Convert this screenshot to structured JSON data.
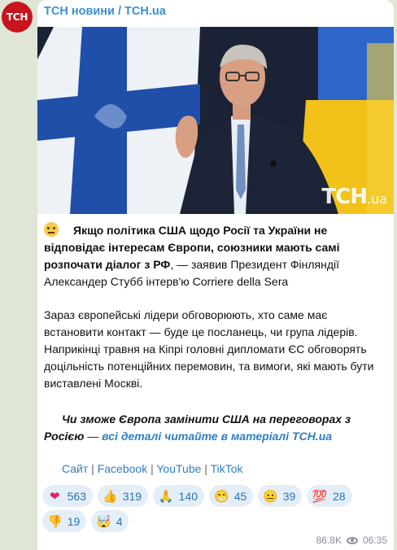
{
  "channel": {
    "avatar_text": "ТСН",
    "name": "ТСН новини / TCH.ua"
  },
  "photo": {
    "description_icon": "photo-stubb-icon",
    "watermark": "TCH",
    "watermark_suffix": ".ua"
  },
  "post": {
    "p1_bold": "Якщо політика США щодо Росії та України не відповідає інтересам Європи, союзники мають самі розпочати діалог з РФ",
    "p1_rest": ", — заявив Президент Фінляндії Александер Стубб інтерв'ю Corriere della Sera",
    "p2": "Зараз європейські лідери обговорюють, хто саме має встановити контакт — буде це посланець, чи група лідерів. Наприкінці травня на Кіпрі головні дипломати ЄС обговорять доцільність потенційних перемовин, та вимоги, які мають бути виставлені Москві.",
    "p3_bold": "Чи зможе Європа замінити США на переговорах з Росією",
    "p3_dash": " — ",
    "p3_link": "всі деталі читайте в матеріалі TCH.ua"
  },
  "links": [
    "Сайт",
    "Facebook",
    "YouTube",
    "TikTok"
  ],
  "links_sep": " | ",
  "reactions": [
    {
      "icon": "heart-icon",
      "glyph": "❤",
      "count": "563"
    },
    {
      "icon": "thumbs-up-icon",
      "glyph": "👍",
      "count": "319"
    },
    {
      "icon": "pray-icon",
      "glyph": "🙏",
      "count": "140"
    },
    {
      "icon": "grin-icon",
      "glyph": "😁",
      "count": "45"
    },
    {
      "icon": "neutral-face-icon",
      "glyph": "😐",
      "count": "39"
    },
    {
      "icon": "hundred-icon",
      "glyph": "💯",
      "count": "28"
    },
    {
      "icon": "thumbs-down-icon",
      "glyph": "👎",
      "count": "19"
    },
    {
      "icon": "mind-blown-icon",
      "glyph": "🤯",
      "count": "4"
    }
  ],
  "meta": {
    "views": "86.8K",
    "time": "06:35"
  },
  "colors": {
    "accent": "#3a8fd0",
    "avatar_bg": "#c8141e",
    "reaction_bg": "#e4eef8",
    "chat_bg": "#dfe6d6"
  }
}
